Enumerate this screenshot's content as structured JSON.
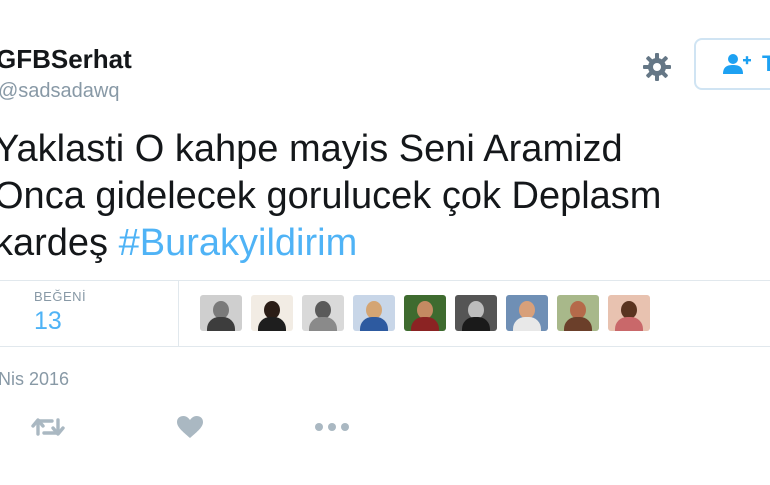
{
  "tweet": {
    "display_name": "GFBSerhat",
    "username": "@sadsadawq",
    "follow_label": "T",
    "text_lines": {
      "line1": "Yaklasti O kahpe mayis Seni Aramizd",
      "line2": "Onca gidelecek gorulucek çok Deplasm",
      "line3_prefix": "kardeş ",
      "hashtag": "#Burakyildirim"
    },
    "stats": {
      "likes_label": "BEĞENİ",
      "likes_count": "13"
    },
    "date": "Nis 2016"
  },
  "icons": {
    "gear": "gear-icon",
    "follow": "add-user-icon",
    "retweet": "retweet-icon",
    "like": "heart-icon",
    "more": "more-dots-icon"
  },
  "colors": {
    "accent": "#1da1f2",
    "hashtag": "#4fb3f6",
    "muted": "#8899a6",
    "action_icon": "#aab8c2",
    "divider": "#e1e8ed"
  }
}
